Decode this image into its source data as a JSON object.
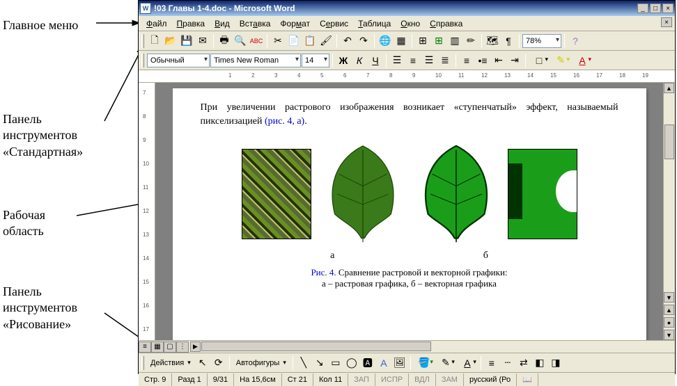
{
  "labels": {
    "main_menu": "Главное меню",
    "standard_toolbar_l1": "Панель",
    "standard_toolbar_l2": "инструментов",
    "standard_toolbar_l3": "«Стандартная»",
    "work_area_l1": "Рабочая",
    "work_area_l2": "область",
    "drawing_toolbar_l1": "Панель",
    "drawing_toolbar_l2": "инструментов",
    "drawing_toolbar_l3": "«Рисование»"
  },
  "titlebar": {
    "icon": "W",
    "text": "!03 Главы 1-4.doc - Microsoft Word"
  },
  "menu": {
    "file": "Файл",
    "edit": "Правка",
    "view": "Вид",
    "insert": "Вставка",
    "format": "Формат",
    "service": "Сервис",
    "table": "Таблица",
    "window": "Окно",
    "help": "Справка"
  },
  "standard_toolbar": {
    "zoom": "78%"
  },
  "format_toolbar": {
    "style": "Обычный",
    "font": "Times New Roman",
    "size": "14"
  },
  "document": {
    "paragraph": "При увеличении растрового изображения возникает «ступенчатый» эффект, называемый пикселизацией ",
    "paragraph_link": "(рис. 4, а)",
    "paragraph_end": ".",
    "label_a": "а",
    "label_b": "б",
    "fig_num": "Рис. 4.",
    "fig_title": " Сравнение растровой и векторной графики:",
    "fig_sub": "а – растровая графика, б – векторная графика"
  },
  "drawbar": {
    "actions": "Действия",
    "autoshapes": "Автофигуры"
  },
  "status": {
    "page": "Стр. 9",
    "section": "Разд 1",
    "pages": "9/31",
    "at": "На 15,6см",
    "line": "Ст 21",
    "col": "Кол 11",
    "rec": "ЗАП",
    "trk": "ИСПР",
    "ext": "ВДЛ",
    "ovr": "ЗАМ",
    "lang": "русский (Ро"
  }
}
